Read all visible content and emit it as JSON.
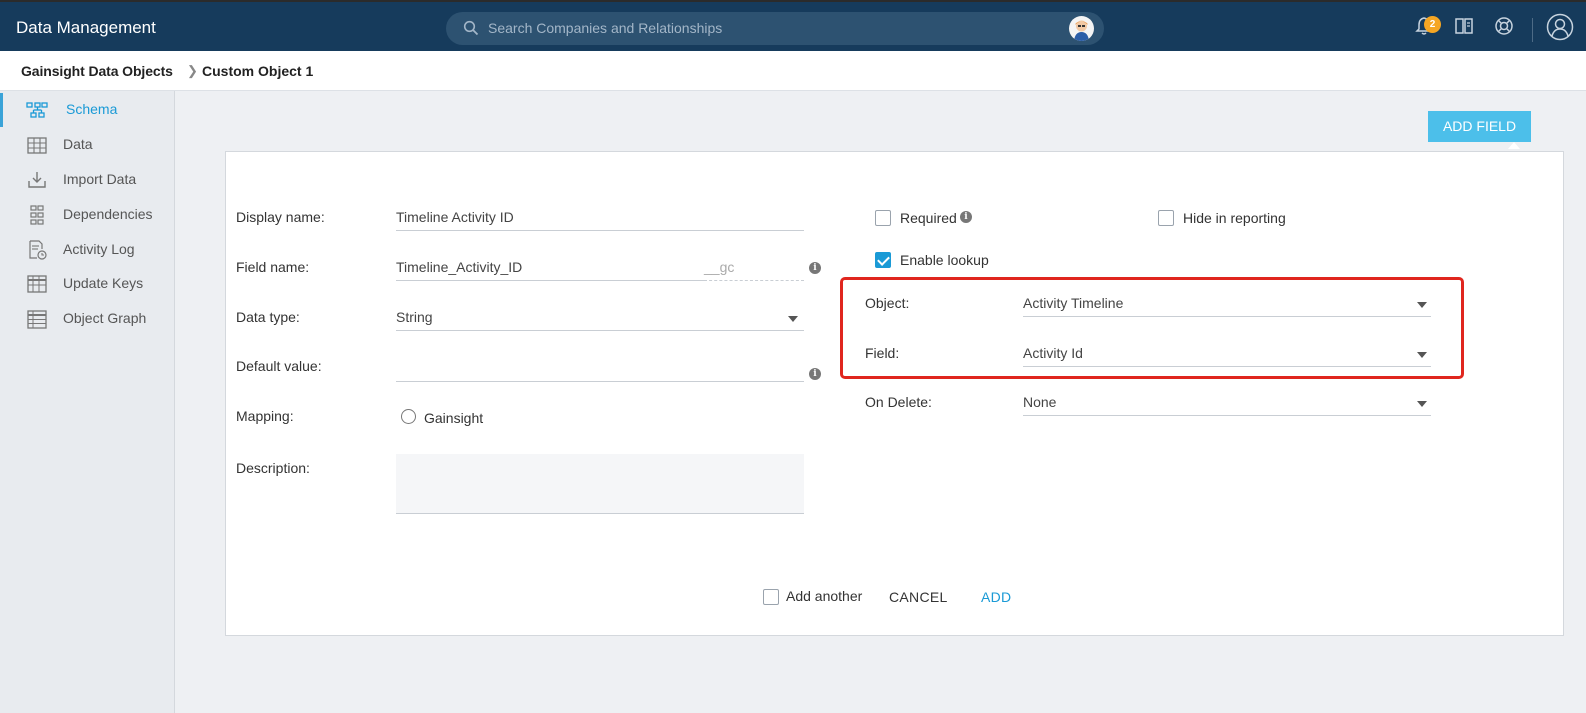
{
  "app": {
    "title": "Data Management"
  },
  "search": {
    "placeholder": "Search Companies and Relationships"
  },
  "notifications": {
    "count": "2"
  },
  "breadcrumb": {
    "root": "Gainsight Data Objects",
    "current": "Custom Object 1"
  },
  "sidebar": {
    "items": [
      {
        "label": "Schema",
        "icon": "schema-icon",
        "active": true
      },
      {
        "label": "Data",
        "icon": "grid-icon"
      },
      {
        "label": "Import Data",
        "icon": "import-icon"
      },
      {
        "label": "Dependencies",
        "icon": "dependencies-icon"
      },
      {
        "label": "Activity Log",
        "icon": "activity-log-icon"
      },
      {
        "label": "Update Keys",
        "icon": "update-keys-icon"
      },
      {
        "label": "Object Graph",
        "icon": "object-graph-icon"
      }
    ]
  },
  "toolbar": {
    "add_field_label": "ADD FIELD"
  },
  "form": {
    "display_name_label": "Display name:",
    "display_name_value": "Timeline Activity ID",
    "field_name_label": "Field name:",
    "field_name_value": "Timeline_Activity_ID",
    "field_name_suffix": "__gc",
    "data_type_label": "Data type:",
    "data_type_value": "String",
    "default_value_label": "Default value:",
    "default_value_value": "",
    "mapping_label": "Mapping:",
    "mapping_option": "Gainsight",
    "description_label": "Description:",
    "required_label": "Required",
    "hide_in_reporting_label": "Hide in reporting",
    "enable_lookup_label": "Enable lookup",
    "object_label": "Object:",
    "object_value": "Activity Timeline",
    "field_label": "Field:",
    "field_value": "Activity Id",
    "on_delete_label": "On Delete:",
    "on_delete_value": "None",
    "add_another_label": "Add another",
    "cancel_label": "CANCEL",
    "add_label": "ADD"
  },
  "colors": {
    "topbar": "#163b5c",
    "accent": "#1a9ad6",
    "add_field_button": "#4cbfea",
    "highlight": "#e0261e",
    "badge": "#f5a623"
  }
}
